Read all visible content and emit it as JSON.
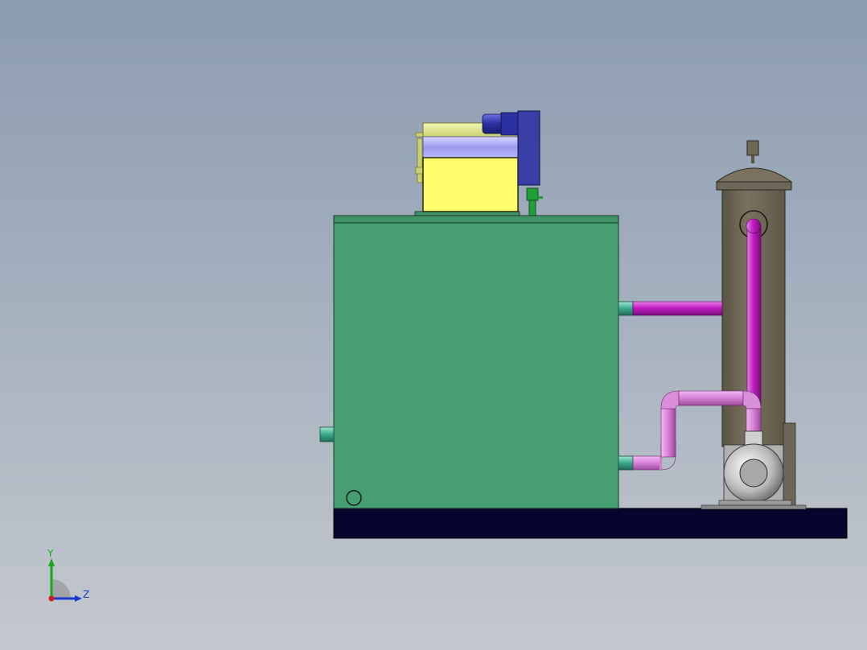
{
  "viewport": {
    "background_top": "#8b9bb0",
    "background_bottom": "#c4c8ce"
  },
  "model": {
    "tank_color": "#479e72",
    "base_color": "#05052e",
    "pipe_color": "#c21ec2",
    "column_color": "#6e6757",
    "motor_blue": "#3a3fa8",
    "hopper_yellow": "#ffff6e",
    "nozzle_teal": "#3aa88a"
  },
  "triad": {
    "y_label": "Y",
    "z_label": "Z",
    "y_color": "#1aa81a",
    "z_color": "#1a3ad4",
    "x_color": "#d41a1a"
  }
}
